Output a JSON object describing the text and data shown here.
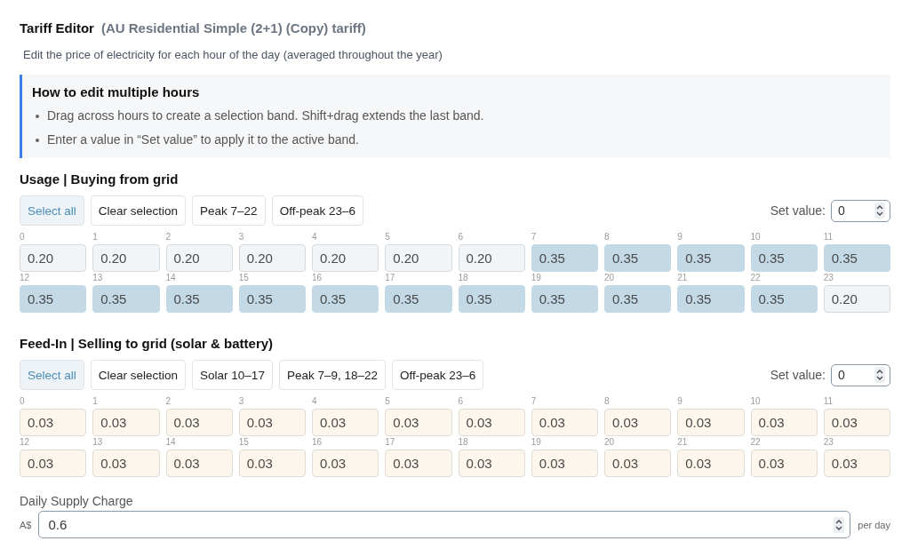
{
  "header": {
    "title": "Tariff Editor",
    "tariff_name": "(AU Residential Simple (2+1) (Copy) tariff)",
    "description": "Edit the price of electricity for each hour of the day (averaged throughout the year)"
  },
  "help": {
    "title": "How to edit multiple hours",
    "items": [
      "Drag across hours to create a selection band. Shift+drag extends the last band.",
      "Enter a value in “Set value” to apply it to the active band."
    ]
  },
  "sections": [
    {
      "kind": "usage",
      "title": "Usage | Buying from grid",
      "buttons": [
        {
          "label": "Select all",
          "kind": "primary"
        },
        {
          "label": "Clear selection",
          "kind": "default"
        },
        {
          "label": "Peak 7–22",
          "kind": "default"
        },
        {
          "label": "Off-peak 23–6",
          "kind": "default"
        }
      ],
      "set_value": {
        "label": "Set value:",
        "value": "0"
      },
      "hours": [
        {
          "hour": "0",
          "value": "0.20",
          "selected": false
        },
        {
          "hour": "1",
          "value": "0.20",
          "selected": false
        },
        {
          "hour": "2",
          "value": "0.20",
          "selected": false
        },
        {
          "hour": "3",
          "value": "0.20",
          "selected": false
        },
        {
          "hour": "4",
          "value": "0.20",
          "selected": false
        },
        {
          "hour": "5",
          "value": "0.20",
          "selected": false
        },
        {
          "hour": "6",
          "value": "0.20",
          "selected": false
        },
        {
          "hour": "7",
          "value": "0.35",
          "selected": true
        },
        {
          "hour": "8",
          "value": "0.35",
          "selected": true
        },
        {
          "hour": "9",
          "value": "0.35",
          "selected": true
        },
        {
          "hour": "10",
          "value": "0.35",
          "selected": true
        },
        {
          "hour": "11",
          "value": "0.35",
          "selected": true
        },
        {
          "hour": "12",
          "value": "0.35",
          "selected": true
        },
        {
          "hour": "13",
          "value": "0.35",
          "selected": true
        },
        {
          "hour": "14",
          "value": "0.35",
          "selected": true
        },
        {
          "hour": "15",
          "value": "0.35",
          "selected": true
        },
        {
          "hour": "16",
          "value": "0.35",
          "selected": true
        },
        {
          "hour": "17",
          "value": "0.35",
          "selected": true
        },
        {
          "hour": "18",
          "value": "0.35",
          "selected": true
        },
        {
          "hour": "19",
          "value": "0.35",
          "selected": true
        },
        {
          "hour": "20",
          "value": "0.35",
          "selected": true
        },
        {
          "hour": "21",
          "value": "0.35",
          "selected": true
        },
        {
          "hour": "22",
          "value": "0.35",
          "selected": true
        },
        {
          "hour": "23",
          "value": "0.20",
          "selected": false
        }
      ]
    },
    {
      "kind": "feed_in",
      "title": "Feed-In | Selling to grid (solar & battery)",
      "buttons": [
        {
          "label": "Select all",
          "kind": "primary"
        },
        {
          "label": "Clear selection",
          "kind": "default"
        },
        {
          "label": "Solar 10–17",
          "kind": "default"
        },
        {
          "label": "Peak 7–9, 18–22",
          "kind": "default"
        },
        {
          "label": "Off-peak 23–6",
          "kind": "default"
        }
      ],
      "set_value": {
        "label": "Set value:",
        "value": "0"
      },
      "hours": [
        {
          "hour": "0",
          "value": "0.03",
          "selected": false
        },
        {
          "hour": "1",
          "value": "0.03",
          "selected": false
        },
        {
          "hour": "2",
          "value": "0.03",
          "selected": false
        },
        {
          "hour": "3",
          "value": "0.03",
          "selected": false
        },
        {
          "hour": "4",
          "value": "0.03",
          "selected": false
        },
        {
          "hour": "5",
          "value": "0.03",
          "selected": false
        },
        {
          "hour": "6",
          "value": "0.03",
          "selected": false
        },
        {
          "hour": "7",
          "value": "0.03",
          "selected": false
        },
        {
          "hour": "8",
          "value": "0.03",
          "selected": false
        },
        {
          "hour": "9",
          "value": "0.03",
          "selected": false
        },
        {
          "hour": "10",
          "value": "0.03",
          "selected": false
        },
        {
          "hour": "11",
          "value": "0.03",
          "selected": false
        },
        {
          "hour": "12",
          "value": "0.03",
          "selected": false
        },
        {
          "hour": "13",
          "value": "0.03",
          "selected": false
        },
        {
          "hour": "14",
          "value": "0.03",
          "selected": false
        },
        {
          "hour": "15",
          "value": "0.03",
          "selected": false
        },
        {
          "hour": "16",
          "value": "0.03",
          "selected": false
        },
        {
          "hour": "17",
          "value": "0.03",
          "selected": false
        },
        {
          "hour": "18",
          "value": "0.03",
          "selected": false
        },
        {
          "hour": "19",
          "value": "0.03",
          "selected": false
        },
        {
          "hour": "20",
          "value": "0.03",
          "selected": false
        },
        {
          "hour": "21",
          "value": "0.03",
          "selected": false
        },
        {
          "hour": "22",
          "value": "0.03",
          "selected": false
        },
        {
          "hour": "23",
          "value": "0.03",
          "selected": false
        }
      ]
    }
  ],
  "daily_supply": {
    "label": "Daily Supply Charge",
    "prefix": "A$",
    "value": "0.6",
    "suffix": "per day"
  }
}
